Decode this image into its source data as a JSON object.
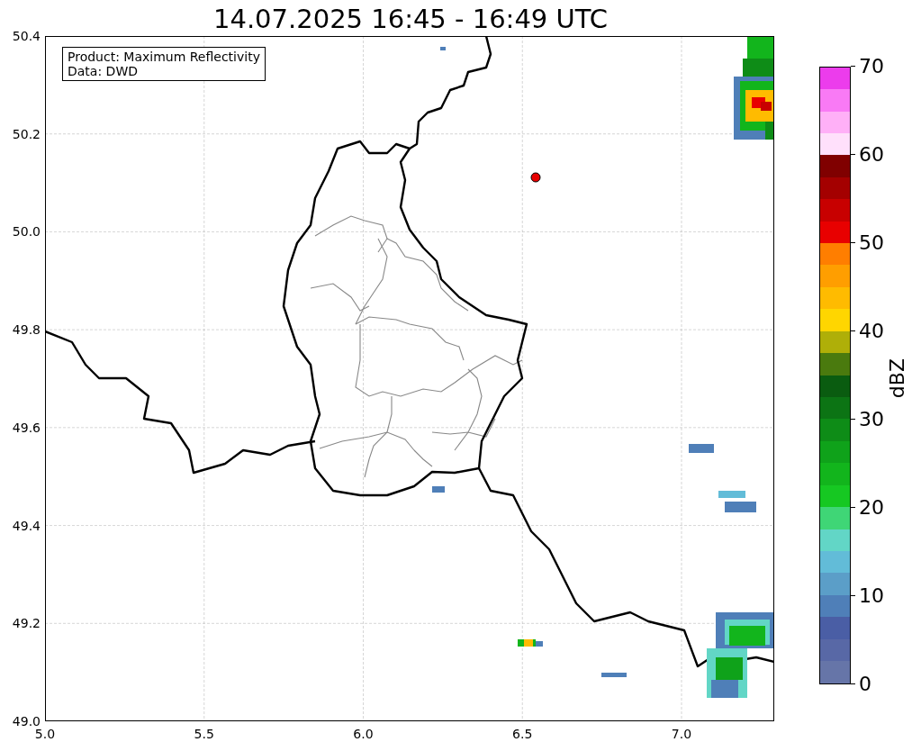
{
  "title": "14.07.2025 16:45 - 16:49 UTC",
  "info_box": [
    "Product: Maximum Reflectivity",
    "Data: DWD"
  ],
  "axes": {
    "xticks": [
      "5.0",
      "5.5",
      "6.0",
      "6.5",
      "7.0"
    ],
    "yticks": [
      "50.4",
      "50.2",
      "50.0",
      "49.8",
      "49.6",
      "49.4",
      "49.2",
      "49.0"
    ]
  },
  "colorbar": {
    "label": "dBZ",
    "ticks": [
      "70",
      "60",
      "50",
      "40",
      "30",
      "20",
      "10",
      "0"
    ],
    "bands": [
      {
        "color": "#6675a8"
      },
      {
        "color": "#5868a6"
      },
      {
        "color": "#4a5ea5"
      },
      {
        "color": "#4f7fb8"
      },
      {
        "color": "#5b9ec8"
      },
      {
        "color": "#62bcd8"
      },
      {
        "color": "#62d6c6"
      },
      {
        "color": "#3fd676"
      },
      {
        "color": "#16c822"
      },
      {
        "color": "#12b51c"
      },
      {
        "color": "#0fa21a"
      },
      {
        "color": "#0e8c17"
      },
      {
        "color": "#0c7414"
      },
      {
        "color": "#0a5c10"
      },
      {
        "color": "#4a7a0e"
      },
      {
        "color": "#afaf08"
      },
      {
        "color": "#ffd600"
      },
      {
        "color": "#ffbb00"
      },
      {
        "color": "#ff9e00"
      },
      {
        "color": "#ff7e00"
      },
      {
        "color": "#e80000"
      },
      {
        "color": "#c80000"
      },
      {
        "color": "#a40000"
      },
      {
        "color": "#800000"
      },
      {
        "color": "#ffe0fb"
      },
      {
        "color": "#ffb0f7"
      },
      {
        "color": "#f97af5"
      },
      {
        "color": "#ec3cec"
      }
    ]
  }
}
